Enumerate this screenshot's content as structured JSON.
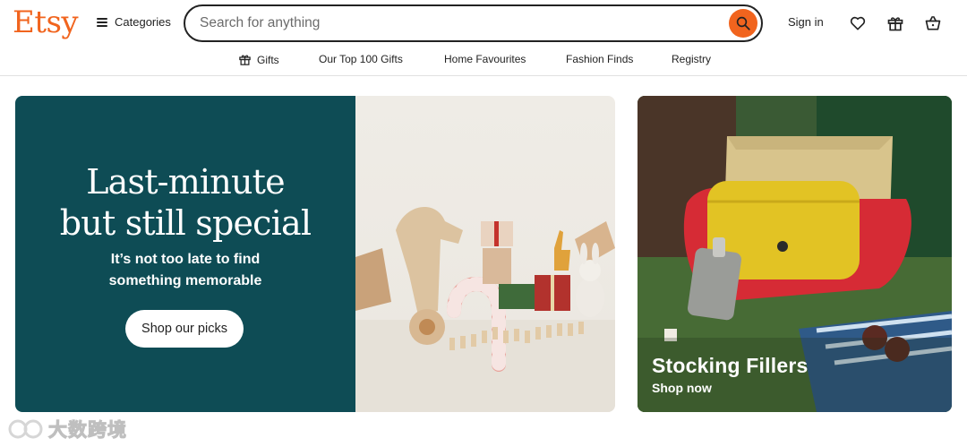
{
  "header": {
    "logo": "Etsy",
    "categories_label": "Categories",
    "search": {
      "placeholder": "Search for anything"
    },
    "signin_label": "Sign in",
    "icons": [
      "heart-icon",
      "gift-icon",
      "basket-icon"
    ]
  },
  "subnav": {
    "items": [
      {
        "label": "Gifts",
        "icon": "gift-icon"
      },
      {
        "label": "Our Top 100 Gifts"
      },
      {
        "label": "Home Favourites"
      },
      {
        "label": "Fashion Finds"
      },
      {
        "label": "Registry"
      }
    ]
  },
  "hero": {
    "title_line1": "Last-minute",
    "title_line2": "but still special",
    "subtitle_line1": "It’s not too late to find",
    "subtitle_line2": "something memorable",
    "button_label": "Shop our picks"
  },
  "card": {
    "title": "Stocking Fillers",
    "link_label": "Shop now"
  },
  "watermark": {
    "text": "大数跨境"
  },
  "colors": {
    "brand": "#F1641E",
    "hero_bg": "#0E4C55",
    "text": "#222222"
  }
}
